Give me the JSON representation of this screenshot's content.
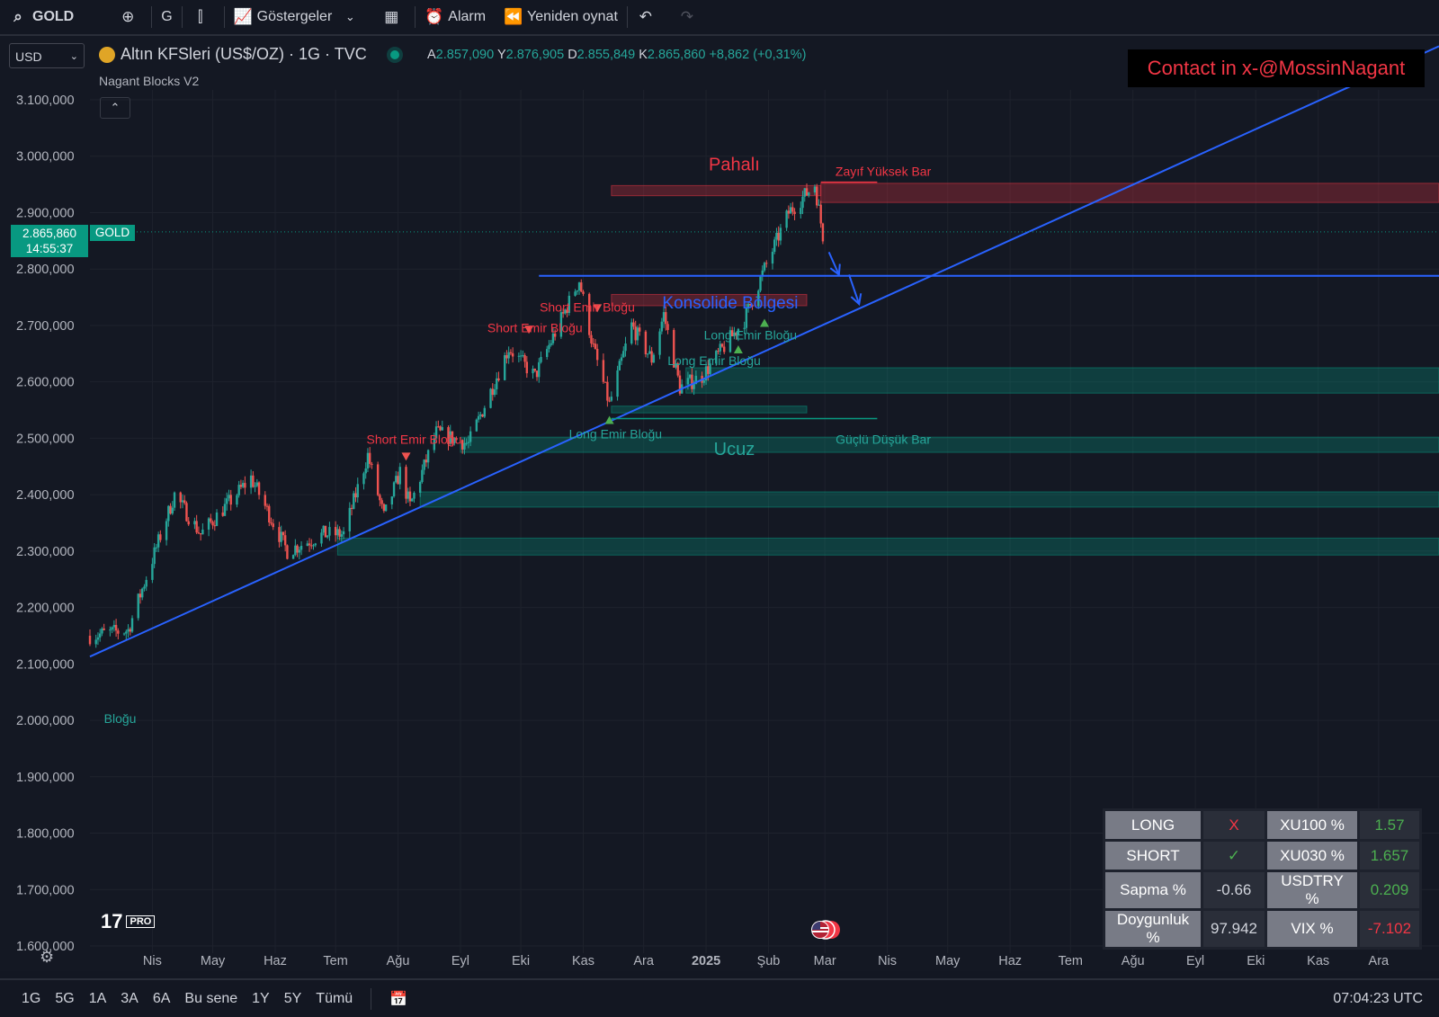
{
  "toolbar": {
    "symbol": "GOLD",
    "interval": "G",
    "indicators_label": "Göstergeler",
    "alarm_label": "Alarm",
    "replay_label": "Yeniden oynat"
  },
  "legend": {
    "name": "Altın KFSleri (US$/OZ) · 1G · TVC",
    "open_label": "A",
    "open": "2.857,090",
    "high_label": "Y",
    "high": "2.876,905",
    "low_label": "D",
    "low": "2.855,849",
    "close_label": "K",
    "close": "2.865,860",
    "change": "+8,862 (+0,31%)",
    "indicator": "Nagant Blocks V2",
    "collapse": "⌃"
  },
  "currency": "USD",
  "contact": "Contact in x-@MossinNagant",
  "price_tag": {
    "price": "2.865,860",
    "time": "14:55:37",
    "symbol": "GOLD"
  },
  "logo": {
    "mark": "17",
    "badge": "PRO"
  },
  "bottombar": {
    "timeframes": [
      "1G",
      "5G",
      "1A",
      "3A",
      "6A",
      "Bu sene",
      "1Y",
      "5Y",
      "Tümü"
    ],
    "clock": "07:04:23 UTC"
  },
  "stats_table": [
    {
      "label": "LONG",
      "value": "X",
      "label2": "XU100 %",
      "value2": "1.57",
      "color": "#f23645",
      "color2": "#4caf50"
    },
    {
      "label": "SHORT",
      "value": "✓",
      "label2": "XU030 %",
      "value2": "1.657",
      "color": "#4caf50",
      "color2": "#4caf50"
    },
    {
      "label": "Sapma %",
      "value": "-0.66",
      "label2": "USDTRY %",
      "value2": "0.209",
      "color": "#d1d4dc",
      "color2": "#4caf50"
    },
    {
      "label": "Doygunluk %",
      "value": "97.942",
      "label2": "VIX %",
      "value2": "-7.102",
      "color": "#d1d4dc",
      "color2": "#f23645"
    }
  ],
  "colors": {
    "up": "#26a69a",
    "down": "#ef5350",
    "trend": "#2962ff",
    "supply": "#f23645",
    "demand": "#089981"
  },
  "chart_data": {
    "type": "candlestick",
    "ylim": [
      1600,
      3100
    ],
    "y_ticks": [
      "3.100,000",
      "3.000,000",
      "2.900,000",
      "2.800,000",
      "2.700,000",
      "2.600,000",
      "2.500,000",
      "2.400,000",
      "2.300,000",
      "2.200,000",
      "2.100,000",
      "2.000,000",
      "1.900,000",
      "1.800,000",
      "1.700,000",
      "1.600,000"
    ],
    "x_ticks": [
      "Nis",
      "May",
      "Haz",
      "Tem",
      "Ağu",
      "Eyl",
      "Eki",
      "Kas",
      "Ara",
      "2025",
      "Şub",
      "Mar",
      "Nis",
      "May",
      "Haz",
      "Tem",
      "Ağu",
      "Eyl",
      "Eki",
      "Kas",
      "Ara"
    ],
    "x_start": "2024-03-01",
    "x_end": "2025-12-31",
    "price_keypoints": [
      [
        "2024-03-01",
        2150
      ],
      [
        "2024-03-20",
        2160
      ],
      [
        "2024-04-12",
        2400
      ],
      [
        "2024-04-25",
        2330
      ],
      [
        "2024-05-20",
        2430
      ],
      [
        "2024-06-07",
        2300
      ],
      [
        "2024-06-25",
        2330
      ],
      [
        "2024-07-05",
        2330
      ],
      [
        "2024-07-17",
        2470
      ],
      [
        "2024-07-25",
        2360
      ],
      [
        "2024-08-02",
        2440
      ],
      [
        "2024-08-07",
        2380
      ],
      [
        "2024-08-20",
        2510
      ],
      [
        "2024-09-05",
        2490
      ],
      [
        "2024-09-25",
        2660
      ],
      [
        "2024-10-08",
        2610
      ],
      [
        "2024-10-30",
        2780
      ],
      [
        "2024-11-06",
        2660
      ],
      [
        "2024-11-14",
        2560
      ],
      [
        "2024-11-25",
        2700
      ],
      [
        "2024-12-05",
        2640
      ],
      [
        "2024-12-11",
        2720
      ],
      [
        "2024-12-19",
        2590
      ],
      [
        "2024-12-30",
        2610
      ],
      [
        "2025-01-20",
        2710
      ],
      [
        "2025-01-30",
        2800
      ],
      [
        "2025-02-11",
        2900
      ],
      [
        "2025-02-24",
        2950
      ],
      [
        "2025-02-28",
        2860
      ]
    ],
    "zones": [
      {
        "kind": "supply",
        "from": "2024-11-15",
        "to": "2025-02-27",
        "y1": 2930,
        "y2": 2948
      },
      {
        "kind": "supply",
        "from": "2025-02-27",
        "to": "2025-12-31",
        "y1": 2918,
        "y2": 2952
      },
      {
        "kind": "supply",
        "from": "2024-11-15",
        "to": "2025-02-20",
        "y1": 2735,
        "y2": 2755
      },
      {
        "kind": "demand",
        "from": "2024-12-22",
        "to": "2025-12-31",
        "y1": 2580,
        "y2": 2625
      },
      {
        "kind": "demand",
        "from": "2024-11-15",
        "to": "2025-02-20",
        "y1": 2545,
        "y2": 2557
      },
      {
        "kind": "demand",
        "from": "2024-09-01",
        "to": "2025-12-31",
        "y1": 2475,
        "y2": 2502
      },
      {
        "kind": "demand",
        "from": "2024-08-12",
        "to": "2025-12-31",
        "y1": 2378,
        "y2": 2405
      },
      {
        "kind": "demand",
        "from": "2024-07-02",
        "to": "2025-12-31",
        "y1": 2293,
        "y2": 2323
      }
    ],
    "lines": [
      {
        "kind": "trend",
        "from": [
          "2024-03-01",
          2113
        ],
        "to": [
          "2025-12-31",
          3195
        ]
      },
      {
        "kind": "horizontal",
        "from": [
          "2024-10-10",
          2788
        ],
        "to": [
          "2025-12-31",
          2788
        ]
      },
      {
        "kind": "supply_edge",
        "from": [
          "2025-02-27",
          2954
        ],
        "to": [
          "2025-03-27",
          2954
        ]
      },
      {
        "kind": "demand_edge",
        "from": [
          "2024-11-15",
          2535
        ],
        "to": [
          "2025-03-27",
          2535
        ]
      }
    ],
    "arrows": [
      {
        "from": [
          "2025-03-03",
          2830
        ],
        "to": [
          "2025-03-08",
          2790
        ]
      },
      {
        "from": [
          "2025-03-13",
          2790
        ],
        "to": [
          "2025-03-18",
          2738
        ]
      }
    ],
    "annotations": [
      {
        "text": "Pahalı",
        "x": "2025-01-15",
        "y": 2975,
        "color": "#f23645",
        "size": 20
      },
      {
        "text": "Zayıf Yüksek Bar",
        "x": "2025-03-30",
        "y": 2965,
        "color": "#f23645",
        "size": 14
      },
      {
        "text": "Ucuz",
        "x": "2025-01-15",
        "y": 2470,
        "color": "#26a69a",
        "size": 20
      },
      {
        "text": "Güçlü Düşük Bar",
        "x": "2025-03-30",
        "y": 2490,
        "color": "#26a69a",
        "size": 14
      },
      {
        "text": "Konsolide Bölgesi",
        "x": "2025-01-13",
        "y": 2730,
        "color": "#2962ff",
        "size": 19
      },
      {
        "text": "Short Emir Bloğu",
        "x": "2024-08-09",
        "y": 2490,
        "color": "#f23645",
        "size": 14
      },
      {
        "text": "Short Emir Bloğu",
        "x": "2024-10-08",
        "y": 2688,
        "color": "#f23645",
        "size": 14
      },
      {
        "text": "Short Emir Bloğu",
        "x": "2024-11-03",
        "y": 2725,
        "color": "#f23645",
        "size": 14
      },
      {
        "text": "Long Emir Bloğu",
        "x": "2024-11-17",
        "y": 2500,
        "color": "#26a69a",
        "size": 14
      },
      {
        "text": "Long Emir Bloğu",
        "x": "2025-01-05",
        "y": 2630,
        "color": "#26a69a",
        "size": 14
      },
      {
        "text": "Long Emir Bloğu",
        "x": "2025-01-23",
        "y": 2675,
        "color": "#26a69a",
        "size": 14
      },
      {
        "text": "Bloğu",
        "x": "2024-03-08",
        "y": 1995,
        "color": "#26a69a",
        "size": 14
      }
    ],
    "markers": [
      {
        "kind": "down",
        "x": "2024-08-05",
        "y": 2465
      },
      {
        "kind": "down",
        "x": "2024-10-05",
        "y": 2690
      },
      {
        "kind": "down",
        "x": "2024-11-08",
        "y": 2728
      },
      {
        "kind": "up",
        "x": "2024-11-14",
        "y": 2535
      },
      {
        "kind": "up",
        "x": "2025-01-17",
        "y": 2660
      },
      {
        "kind": "up",
        "x": "2025-01-30",
        "y": 2707
      }
    ]
  }
}
